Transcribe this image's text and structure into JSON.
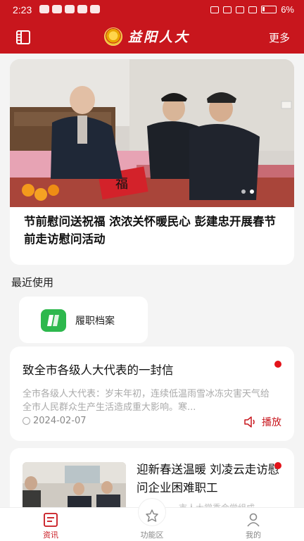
{
  "status_bar": {
    "time": "2:23",
    "battery": "6%"
  },
  "header": {
    "title": "益阳人大",
    "more_label": "更多"
  },
  "hero": {
    "title": "节前慰问送祝福 浓浓关怀暖民心 彭建忠开展春节前走访慰问活动"
  },
  "recent": {
    "section_label": "最近使用",
    "items": [
      {
        "label": "履职档案",
        "icon": "archive-icon"
      }
    ]
  },
  "news": [
    {
      "title": "致全市各级人大代表的一封信",
      "summary": "全市各级人大代表：岁末年初，连续低温雨雪冰冻灾害天气给全市人民群众生产生活造成重大影响。寒...",
      "date": "2024-02-07",
      "play_label": "播放"
    },
    {
      "title": "迎新春送温暖 刘凌云走访慰问企业困难职工",
      "summary": "市人大常委会党组成"
    }
  ],
  "nav": {
    "items": [
      {
        "label": "资讯"
      },
      {
        "label": "功能区"
      },
      {
        "label": "我的"
      }
    ]
  },
  "colors": {
    "brand_red": "#c8161d",
    "accent_green": "#2db84d"
  }
}
